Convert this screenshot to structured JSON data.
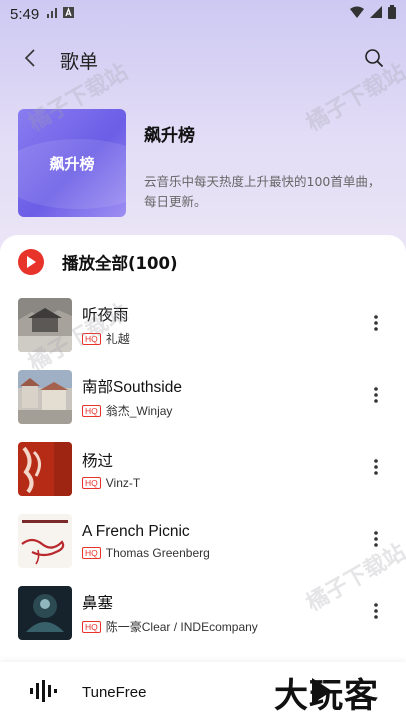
{
  "status_bar": {
    "time": "5:49"
  },
  "header": {
    "title": "歌单"
  },
  "playlist": {
    "cover_text": "飙升榜",
    "name": "飙升榜",
    "description": "云音乐中每天热度上升最快的100首单曲，每日更新。"
  },
  "play_all": {
    "label": "播放全部(100)"
  },
  "songs": [
    {
      "title": "听夜雨",
      "badge": "HQ",
      "artist": "礼越"
    },
    {
      "title": "南部Southside",
      "badge": "HQ",
      "artist": "翁杰_Winjay"
    },
    {
      "title": "杨过",
      "badge": "HQ",
      "artist": "Vinz-T"
    },
    {
      "title": "A French Picnic",
      "badge": "HQ",
      "artist": "Thomas Greenberg"
    },
    {
      "title": "鼻塞",
      "badge": "HQ",
      "artist": "陈一豪Clear / INDEcompany"
    }
  ],
  "mini_player": {
    "title": "TuneFree"
  },
  "watermark": "橘子下载站",
  "corner_mark": "大玩客",
  "colors": {
    "accent": "#e8332a",
    "cover_purple": "#6c5ee6"
  }
}
